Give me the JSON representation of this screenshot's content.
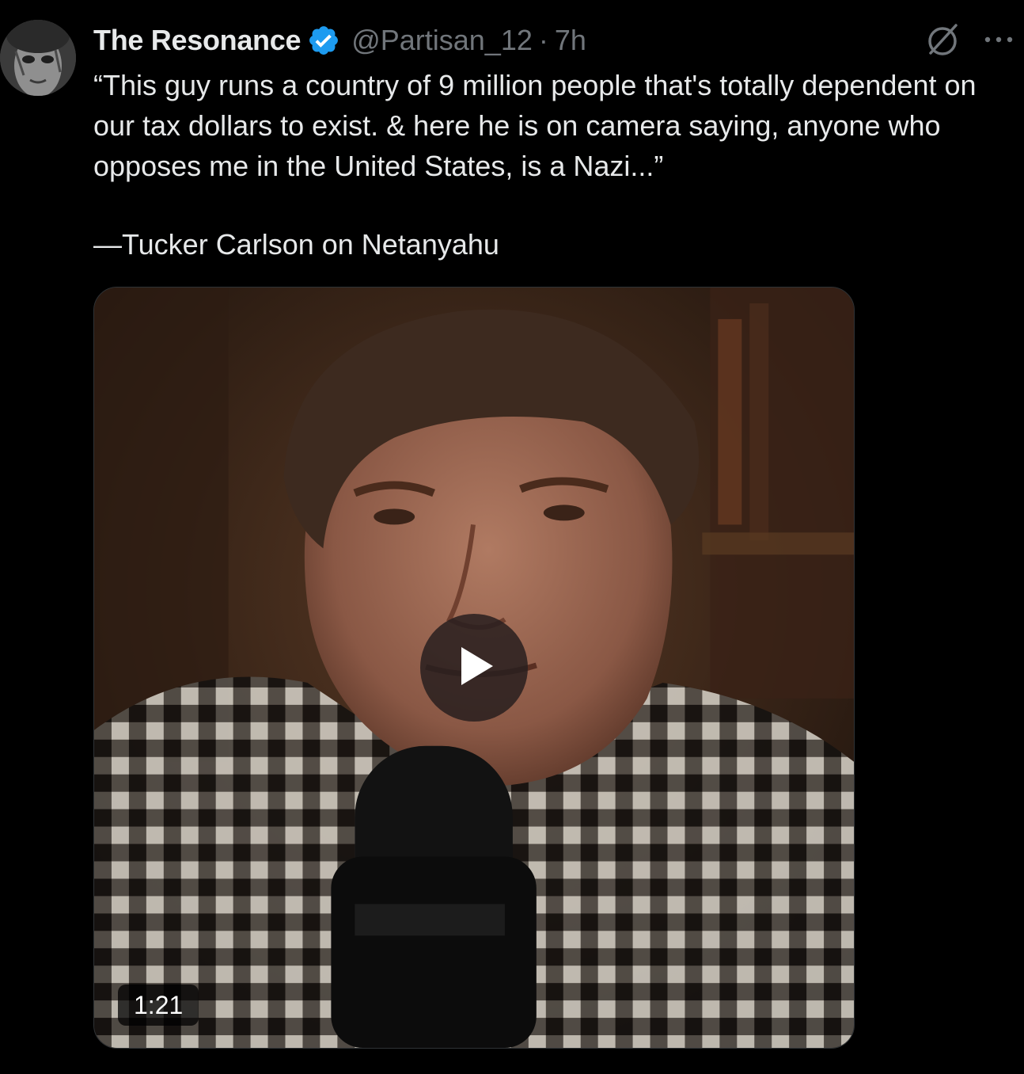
{
  "author": {
    "display_name": "The Resonance",
    "verified": true,
    "handle": "@Partisan_12",
    "separator": "·",
    "time": "7h",
    "verified_color": "#1d9bf0"
  },
  "icons": {
    "grok": "grok-slash-circle-icon",
    "more": "more-options-icon",
    "verified": "verified-badge-icon",
    "play": "play-icon"
  },
  "tweet": {
    "text_lines": [
      "“This guy runs a country of 9 million people that's totally dependent on our tax dollars to exist. & here he is on camera saying, anyone who opposes me in the United States, is a Nazi...”",
      "—Tucker Carlson on Netanyahu"
    ]
  },
  "media": {
    "type": "video",
    "duration": "1:21"
  },
  "colors": {
    "background": "#000000",
    "text": "#e7e9ea",
    "muted": "#71767b"
  }
}
